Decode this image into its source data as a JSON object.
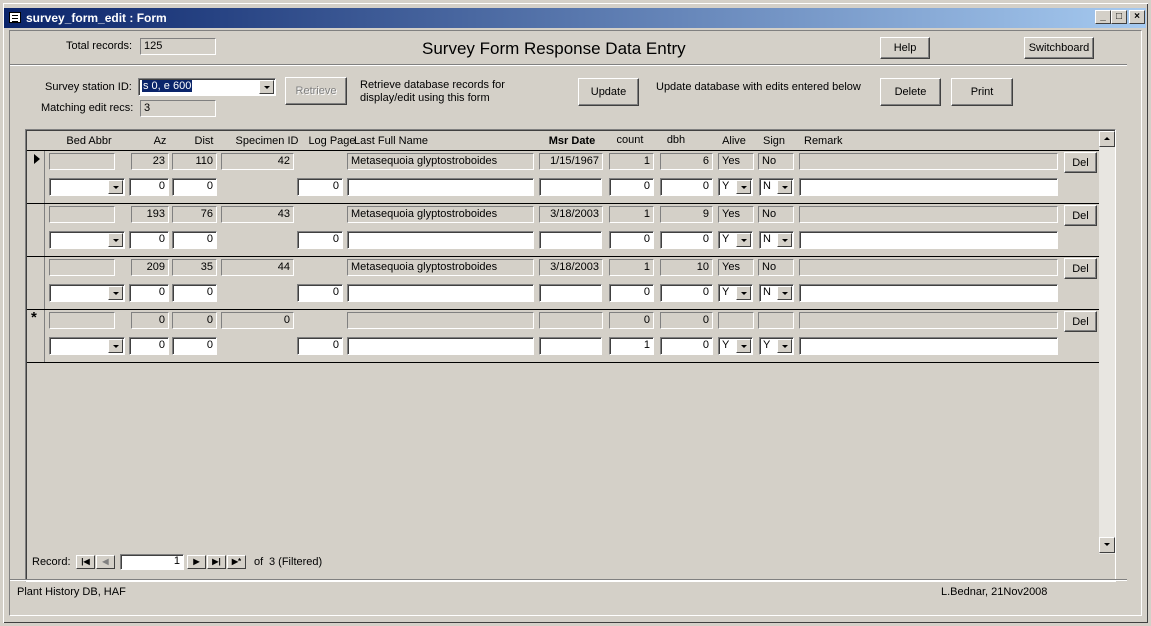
{
  "window": {
    "title": "survey_form_edit : Form",
    "min": "_",
    "max": "□",
    "close": "×"
  },
  "header": {
    "total_records_label": "Total records:",
    "total_records_value": "125",
    "page_title": "Survey Form Response Data Entry",
    "help_label": "Help",
    "switchboard_label": "Switchboard"
  },
  "controls": {
    "station_label": "Survey station ID:",
    "station_value": "s 0, e 600",
    "matching_label": "Matching edit recs:",
    "matching_value": "3",
    "retrieve_label": "Retrieve",
    "retrieve_desc": "Retrieve database records for display/edit using this form",
    "update_label": "Update",
    "update_desc": "Update database with edits entered below",
    "delete_label": "Delete",
    "print_label": "Print"
  },
  "columns": {
    "bed": "Bed Abbr",
    "az": "Az",
    "dist": "Dist",
    "specimen": "Specimen ID",
    "logpage": "Log Page",
    "name": "Last Full Name",
    "msr": "Msr Date",
    "count": "count",
    "dbh": "dbh",
    "alive": "Alive",
    "sign": "Sign",
    "remark": "Remark"
  },
  "records": [
    {
      "az": "23",
      "dist": "110",
      "specimen": "42",
      "name": "Metasequoia glyptostroboides",
      "msr": "1/15/1967",
      "count": "1",
      "dbh": "6",
      "alive": "Yes",
      "sign": "No",
      "del": "Del",
      "e_az": "0",
      "e_dist": "0",
      "e_log": "0",
      "e_count": "0",
      "e_dbh": "0",
      "e_alive": "Y",
      "e_sign": "N"
    },
    {
      "az": "193",
      "dist": "76",
      "specimen": "43",
      "name": "Metasequoia glyptostroboides",
      "msr": "3/18/2003",
      "count": "1",
      "dbh": "9",
      "alive": "Yes",
      "sign": "No",
      "del": "Del",
      "e_az": "0",
      "e_dist": "0",
      "e_log": "0",
      "e_count": "0",
      "e_dbh": "0",
      "e_alive": "Y",
      "e_sign": "N"
    },
    {
      "az": "209",
      "dist": "35",
      "specimen": "44",
      "name": "Metasequoia glyptostroboides",
      "msr": "3/18/2003",
      "count": "1",
      "dbh": "10",
      "alive": "Yes",
      "sign": "No",
      "del": "Del",
      "e_az": "0",
      "e_dist": "0",
      "e_log": "0",
      "e_count": "0",
      "e_dbh": "0",
      "e_alive": "Y",
      "e_sign": "N"
    },
    {
      "az": "0",
      "dist": "0",
      "specimen": "0",
      "name": "",
      "msr": "",
      "count": "0",
      "dbh": "0",
      "alive": "",
      "sign": "",
      "del": "Del",
      "e_az": "0",
      "e_dist": "0",
      "e_log": "0",
      "e_count": "1",
      "e_dbh": "0",
      "e_alive": "Y",
      "e_sign": "Y"
    }
  ],
  "navigator": {
    "label": "Record:",
    "current": "1",
    "of": "of",
    "total": "3 (Filtered)"
  },
  "footer": {
    "left": "Plant History DB, HAF",
    "right": "L.Bednar, 21Nov2008"
  }
}
